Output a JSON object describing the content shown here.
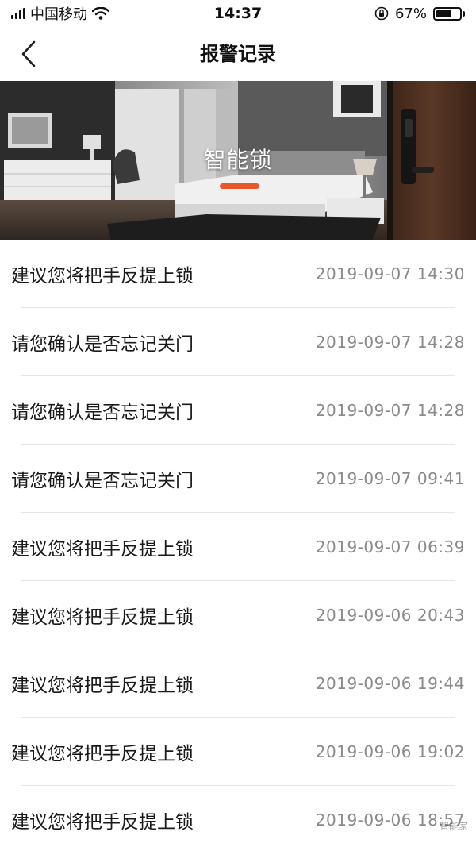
{
  "status_bar": {
    "carrier": "中国移动",
    "time": "14:37",
    "battery_percent": "67%",
    "battery_level": 0.67,
    "icons": [
      "signal-icon",
      "wifi-icon",
      "orientation-lock-icon",
      "battery-icon"
    ]
  },
  "nav": {
    "title": "报警记录",
    "back_icon": "chevron-left-icon"
  },
  "banner": {
    "title": "智能锁",
    "accent_color": "#e8572a"
  },
  "alarms": [
    {
      "message": "建议您将把手反提上锁",
      "time": "2019-09-07 14:30"
    },
    {
      "message": "请您确认是否忘记关门",
      "time": "2019-09-07 14:28"
    },
    {
      "message": "请您确认是否忘记关门",
      "time": "2019-09-07 14:28"
    },
    {
      "message": "请您确认是否忘记关门",
      "time": "2019-09-07 09:41"
    },
    {
      "message": "建议您将把手反提上锁",
      "time": "2019-09-07 06:39"
    },
    {
      "message": "建议您将把手反提上锁",
      "time": "2019-09-06 20:43"
    },
    {
      "message": "建议您将把手反提上锁",
      "time": "2019-09-06 19:44"
    },
    {
      "message": "建议您将把手反提上锁",
      "time": "2019-09-06 19:02"
    },
    {
      "message": "建议您将把手反提上锁",
      "time": "2019-09-06 18:57"
    }
  ],
  "watermark": "智能家"
}
